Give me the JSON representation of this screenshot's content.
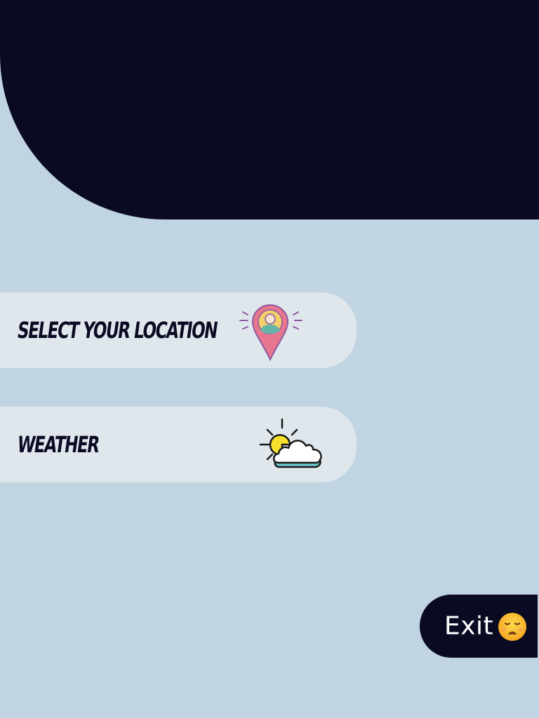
{
  "menu": {
    "items": [
      {
        "label": "SELECT YOUR LOCATION",
        "icon": "location-pin-icon"
      },
      {
        "label": "WEATHER",
        "icon": "sun-cloud-icon"
      }
    ]
  },
  "exit": {
    "label": "Exit",
    "icon": "sad-face-icon"
  },
  "colors": {
    "background": "#c0d4e1",
    "dark": "#0a0a23",
    "card": "#dfe7ed",
    "pin": "#e7778f",
    "sun": "#f7e02d",
    "cloud": "#6ec9cf"
  }
}
